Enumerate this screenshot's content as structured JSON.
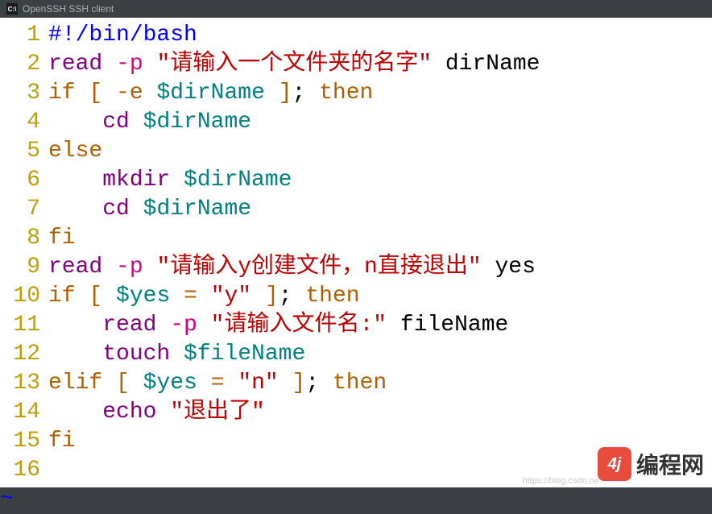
{
  "titlebar": {
    "app_icon": "C:\\",
    "title": "OpenSSH SSH client"
  },
  "code": {
    "lines": [
      {
        "n": "1",
        "tokens": [
          {
            "cls": "c-blue",
            "t": "#!/bin/bash"
          }
        ]
      },
      {
        "n": "2",
        "tokens": [
          {
            "cls": "c-purple",
            "t": "read"
          },
          {
            "cls": "c-black",
            "t": " "
          },
          {
            "cls": "c-magenta",
            "t": "-p"
          },
          {
            "cls": "c-black",
            "t": " "
          },
          {
            "cls": "c-red",
            "t": "\"请输入一个文件夹的名字\""
          },
          {
            "cls": "c-black",
            "t": " dirName"
          }
        ]
      },
      {
        "n": "3",
        "tokens": [
          {
            "cls": "c-darkorange",
            "t": "if"
          },
          {
            "cls": "c-black",
            "t": " "
          },
          {
            "cls": "c-darkorange",
            "t": "["
          },
          {
            "cls": "c-black",
            "t": " "
          },
          {
            "cls": "c-darkorange",
            "t": "-e"
          },
          {
            "cls": "c-black",
            "t": " "
          },
          {
            "cls": "c-teal",
            "t": "$dirName"
          },
          {
            "cls": "c-black",
            "t": " "
          },
          {
            "cls": "c-darkorange",
            "t": "]"
          },
          {
            "cls": "c-black",
            "t": "; "
          },
          {
            "cls": "c-darkorange",
            "t": "then"
          }
        ]
      },
      {
        "n": "4",
        "tokens": [
          {
            "cls": "c-black",
            "t": "    "
          },
          {
            "cls": "c-purple",
            "t": "cd"
          },
          {
            "cls": "c-black",
            "t": " "
          },
          {
            "cls": "c-teal",
            "t": "$dirName"
          }
        ]
      },
      {
        "n": "5",
        "tokens": [
          {
            "cls": "c-darkorange",
            "t": "else"
          }
        ]
      },
      {
        "n": "6",
        "tokens": [
          {
            "cls": "c-black",
            "t": "    "
          },
          {
            "cls": "c-purple",
            "t": "mkdir"
          },
          {
            "cls": "c-black",
            "t": " "
          },
          {
            "cls": "c-teal",
            "t": "$dirName"
          }
        ]
      },
      {
        "n": "7",
        "tokens": [
          {
            "cls": "c-black",
            "t": "    "
          },
          {
            "cls": "c-purple",
            "t": "cd"
          },
          {
            "cls": "c-black",
            "t": " "
          },
          {
            "cls": "c-teal",
            "t": "$dirName"
          }
        ]
      },
      {
        "n": "8",
        "tokens": [
          {
            "cls": "c-darkorange",
            "t": "fi"
          }
        ]
      },
      {
        "n": "9",
        "tokens": [
          {
            "cls": "c-purple",
            "t": "read"
          },
          {
            "cls": "c-black",
            "t": " "
          },
          {
            "cls": "c-magenta",
            "t": "-p"
          },
          {
            "cls": "c-black",
            "t": " "
          },
          {
            "cls": "c-red",
            "t": "\"请输入y创建文件，n直接退出\""
          },
          {
            "cls": "c-black",
            "t": " yes"
          }
        ]
      },
      {
        "n": "10",
        "tokens": [
          {
            "cls": "c-darkorange",
            "t": "if"
          },
          {
            "cls": "c-black",
            "t": " "
          },
          {
            "cls": "c-darkorange",
            "t": "["
          },
          {
            "cls": "c-black",
            "t": " "
          },
          {
            "cls": "c-teal",
            "t": "$yes"
          },
          {
            "cls": "c-black",
            "t": " "
          },
          {
            "cls": "c-darkorange",
            "t": "="
          },
          {
            "cls": "c-black",
            "t": " "
          },
          {
            "cls": "c-red",
            "t": "\"y\""
          },
          {
            "cls": "c-black",
            "t": " "
          },
          {
            "cls": "c-darkorange",
            "t": "]"
          },
          {
            "cls": "c-black",
            "t": "; "
          },
          {
            "cls": "c-darkorange",
            "t": "then"
          }
        ]
      },
      {
        "n": "11",
        "tokens": [
          {
            "cls": "c-black",
            "t": "    "
          },
          {
            "cls": "c-purple",
            "t": "read"
          },
          {
            "cls": "c-black",
            "t": " "
          },
          {
            "cls": "c-magenta",
            "t": "-p"
          },
          {
            "cls": "c-black",
            "t": " "
          },
          {
            "cls": "c-red",
            "t": "\"请输入文件名:\""
          },
          {
            "cls": "c-black",
            "t": " fileName"
          }
        ]
      },
      {
        "n": "12",
        "tokens": [
          {
            "cls": "c-black",
            "t": "    "
          },
          {
            "cls": "c-purple",
            "t": "touch"
          },
          {
            "cls": "c-black",
            "t": " "
          },
          {
            "cls": "c-teal",
            "t": "$fileName"
          }
        ]
      },
      {
        "n": "13",
        "tokens": [
          {
            "cls": "c-darkorange",
            "t": "elif"
          },
          {
            "cls": "c-black",
            "t": " "
          },
          {
            "cls": "c-darkorange",
            "t": "["
          },
          {
            "cls": "c-black",
            "t": " "
          },
          {
            "cls": "c-teal",
            "t": "$yes"
          },
          {
            "cls": "c-black",
            "t": " "
          },
          {
            "cls": "c-darkorange",
            "t": "="
          },
          {
            "cls": "c-black",
            "t": " "
          },
          {
            "cls": "c-red",
            "t": "\"n\""
          },
          {
            "cls": "c-black",
            "t": " "
          },
          {
            "cls": "c-darkorange",
            "t": "]"
          },
          {
            "cls": "c-black",
            "t": "; "
          },
          {
            "cls": "c-darkorange",
            "t": "then"
          }
        ]
      },
      {
        "n": "14",
        "tokens": [
          {
            "cls": "c-black",
            "t": "    "
          },
          {
            "cls": "c-purple",
            "t": "echo"
          },
          {
            "cls": "c-black",
            "t": " "
          },
          {
            "cls": "c-red",
            "t": "\"退出了\""
          }
        ]
      },
      {
        "n": "15",
        "tokens": [
          {
            "cls": "c-darkorange",
            "t": "fi"
          }
        ]
      },
      {
        "n": "16",
        "tokens": []
      }
    ],
    "tilde": "~"
  },
  "watermark": {
    "logo": "4j",
    "text": "编程网",
    "url": "https://blog.csdn.ne"
  }
}
